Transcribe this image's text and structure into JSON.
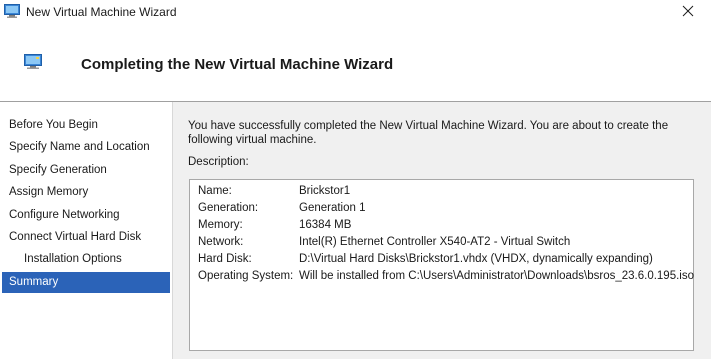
{
  "window": {
    "title": "New Virtual Machine Wizard"
  },
  "header": {
    "title": "Completing the New Virtual Machine Wizard"
  },
  "nav": {
    "items": [
      {
        "label": "Before You Begin"
      },
      {
        "label": "Specify Name and Location"
      },
      {
        "label": "Specify Generation"
      },
      {
        "label": "Assign Memory"
      },
      {
        "label": "Configure Networking"
      },
      {
        "label": "Connect Virtual Hard Disk"
      },
      {
        "label": "Installation Options"
      },
      {
        "label": "Summary"
      }
    ],
    "selected": "Summary"
  },
  "main": {
    "intro": "You have successfully completed the New Virtual Machine Wizard. You are about to create the following virtual machine.",
    "description_label": "Description:",
    "summary": [
      {
        "key": "Name:",
        "value": "Brickstor1"
      },
      {
        "key": "Generation:",
        "value": "Generation 1"
      },
      {
        "key": "Memory:",
        "value": "16384 MB"
      },
      {
        "key": "Network:",
        "value": "Intel(R) Ethernet Controller X540-AT2 - Virtual Switch"
      },
      {
        "key": "Hard Disk:",
        "value": "D:\\Virtual Hard Disks\\Brickstor1.vhdx (VHDX, dynamically expanding)"
      },
      {
        "key": "Operating System:",
        "value": "Will be installed from C:\\Users\\Administrator\\Downloads\\bsros_23.6.0.195.iso"
      }
    ]
  },
  "colors": {
    "selection": "#2b63b8",
    "panel_bg": "#f0f0f0"
  },
  "icons": {
    "title": "virtual-machine-icon",
    "header": "virtual-machine-icon",
    "close": "close-icon"
  }
}
